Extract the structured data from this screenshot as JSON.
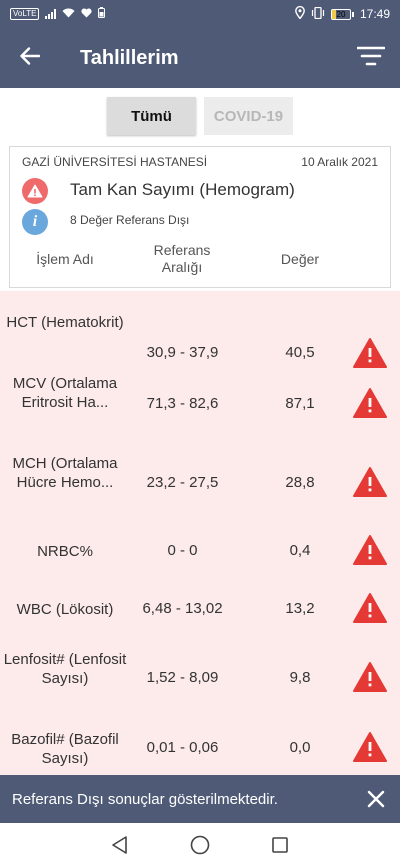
{
  "status_bar": {
    "network": "VoLTE",
    "battery": "20",
    "time": "17:49"
  },
  "app_bar": {
    "title": "Tahlillerim"
  },
  "filters": {
    "all_label": "Tümü",
    "covid_label": "COVID-19"
  },
  "card": {
    "hospital": "GAZİ ÜNİVERSİTESİ HASTANESİ",
    "date": "10 Aralık 2021",
    "test_name": "Tam Kan Sayımı (Hemogram)",
    "out_of_range_count": "8 Değer Referans Dışı",
    "headers": {
      "name": "İşlem Adı",
      "reference": "Referans Aralığı",
      "value": "Değer"
    }
  },
  "results": [
    {
      "name": "HCT (Hematokrit)",
      "reference": "30,9 - 37,9",
      "value": "40,5"
    },
    {
      "name": "MCV (Ortalama Eritrosit Ha...",
      "reference": "71,3 - 82,6",
      "value": "87,1"
    },
    {
      "name": "MCH (Ortalama Hücre Hemo...",
      "reference": "23,2 - 27,5",
      "value": "28,8"
    },
    {
      "name": "NRBC%",
      "reference": "0 - 0",
      "value": "0,4"
    },
    {
      "name": "WBC (Lökosit)",
      "reference": "6,48 - 13,02",
      "value": "13,2"
    },
    {
      "name": "Lenfosit# (Lenfosit Sayısı)",
      "reference": "1,52 - 8,09",
      "value": "9,8"
    },
    {
      "name": "Bazofil# (Bazofil Sayısı)",
      "reference": "0,01 - 0,06",
      "value": "0,0"
    }
  ],
  "snackbar": {
    "message": "Referans Dışı sonuçlar gösterilmektedir."
  },
  "colors": {
    "primary": "#4f5b76",
    "alert": "#e53935",
    "row_background": "#fdeaea",
    "info": "#6aa7dc"
  },
  "icons": {
    "back": "arrow-left-icon",
    "filter": "filter-icon",
    "warning": "warning-icon",
    "info": "info-icon",
    "close": "close-icon",
    "nav_back": "triangle-back-icon",
    "nav_home": "circle-home-icon",
    "nav_recent": "square-recent-icon"
  }
}
